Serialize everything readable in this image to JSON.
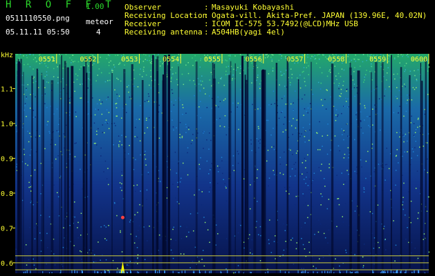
{
  "header": {
    "app_title": "H R O F F T",
    "app_version": "1.00",
    "filename": "0511110550.png",
    "meteor_label": "meteor",
    "datetime": "05.11.11 05:50",
    "meteor_count": "4"
  },
  "metadata": [
    {
      "key": "Observer",
      "sep": ":",
      "value": "Masayuki Kobayashi"
    },
    {
      "key": "Receiving Location",
      "sep": ":",
      "value": "Ogata-vill. Akita-Pref. JAPAN (139.96E, 40.02N)"
    },
    {
      "key": "Receiver",
      "sep": ":",
      "value": "ICOM IC-575 53.7492(@LCD)MHz USB"
    },
    {
      "key": "Receiving antenna",
      "sep": ":",
      "value": "A504HB(yagi 4el)"
    }
  ],
  "colors": {
    "background": "#000000",
    "tick_text": "#ffff33",
    "title_green": "#2bd82b",
    "spectrum_low": "#001a66",
    "spectrum_high": "#33cc66"
  },
  "chart_data": {
    "type": "heatmap",
    "ylabel": "kHz",
    "ylim": [
      0.57,
      1.2
    ],
    "y_ticks": [
      "1.1",
      "1.0",
      "0.9",
      "0.8",
      "0.7",
      "0.6"
    ],
    "y_tick_values": [
      1.1,
      1.0,
      0.9,
      0.8,
      0.7,
      0.6
    ],
    "x_ticks": [
      "0551",
      "0552",
      "0553",
      "0554",
      "0555",
      "0556",
      "0557",
      "0558",
      "0559",
      "0600"
    ],
    "x_tick_values": [
      1,
      2,
      3,
      4,
      5,
      6,
      7,
      8,
      9,
      10
    ],
    "xlim": [
      0,
      10
    ],
    "reference_lines_khz": [
      0.62,
      0.6,
      0.58
    ],
    "meteor_echo": {
      "minute": 2.6,
      "khz": 0.73
    },
    "spike": {
      "minute": 2.6,
      "khz_top": 0.604
    }
  }
}
